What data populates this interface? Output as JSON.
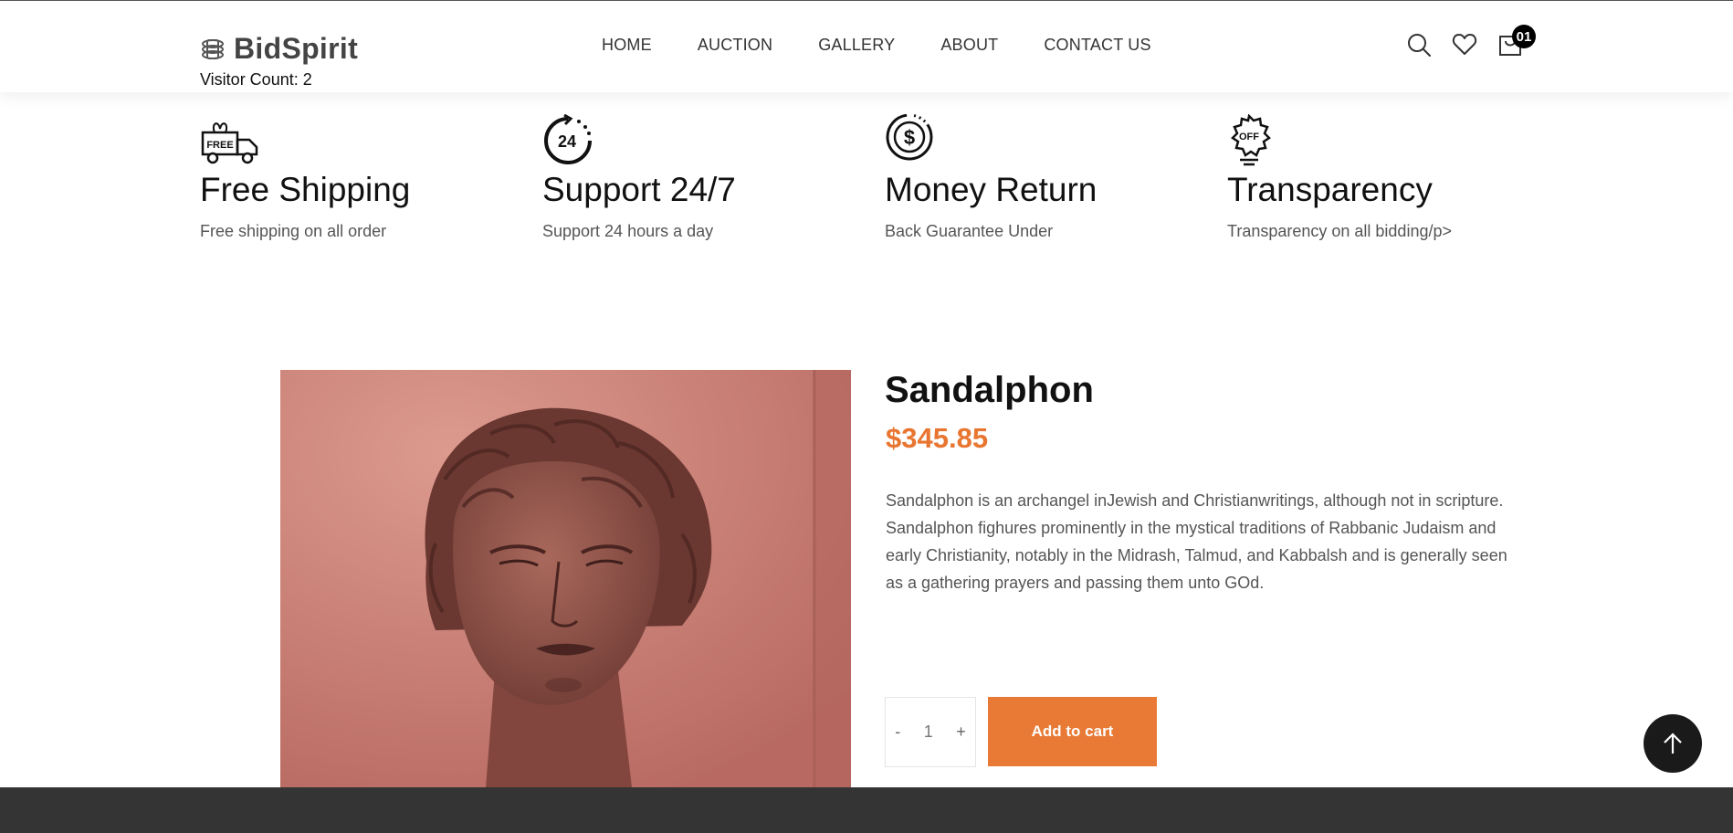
{
  "header": {
    "logo_text": "BidSpirit",
    "visitor_count": "Visitor Count: 2",
    "nav": [
      "HOME",
      "AUCTION",
      "GALLERY",
      "ABOUT",
      "CONTACT US"
    ],
    "cart_count": "01"
  },
  "features": [
    {
      "icon": "free-truck-icon",
      "title": "Free Shipping",
      "desc": "Free shipping on all order"
    },
    {
      "icon": "support-24-icon",
      "title": "Support 24/7",
      "desc": "Support 24 hours a day"
    },
    {
      "icon": "money-return-icon",
      "title": "Money Return",
      "desc": "Back Guarantee Under"
    },
    {
      "icon": "off-badge-icon",
      "title": "Transparency",
      "desc": "Transparency on all bidding/p>"
    }
  ],
  "product": {
    "name": "Sandalphon",
    "price": "$345.85",
    "description": "Sandalphon is an archangel inJewish and Christianwritings, although not in scripture. Sandalphon fighures prominently in the mystical traditions of Rabbanic Judaism and early Christianity, notably in the Midrash, Talmud, and Kabbalsh and is generally seen as a gathering prayers and passing them unto GOd.",
    "quantity": "1",
    "qty_minus": "-",
    "qty_plus": "+",
    "add_to_cart": "Add to cart"
  },
  "colors": {
    "accent": "#e87a35",
    "price": "#e87530",
    "footer": "#343434",
    "image_bg": "#c77a70"
  }
}
